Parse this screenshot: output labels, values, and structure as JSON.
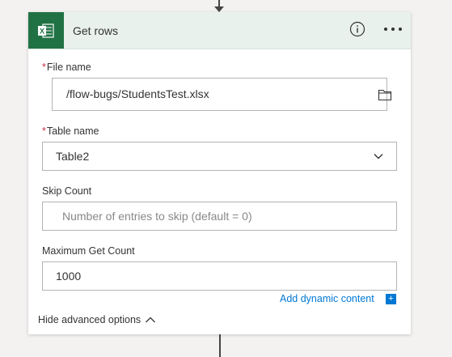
{
  "header": {
    "title": "Get rows",
    "connector_icon": "excel-icon",
    "info_icon": "info-icon",
    "more_icon": "more-options-icon"
  },
  "fields": {
    "file_name": {
      "label": "File name",
      "required_mark": "*",
      "value": "/flow-bugs/StudentsTest.xlsx",
      "icon": "folder-icon"
    },
    "table_name": {
      "label": "Table name",
      "required_mark": "*",
      "value": "Table2",
      "icon": "chevron-down-icon"
    },
    "skip_count": {
      "label": "Skip Count",
      "value": "",
      "placeholder": "Number of entries to skip (default = 0)"
    },
    "max_get_count": {
      "label": "Maximum Get Count",
      "value": "1000"
    }
  },
  "footer": {
    "dynamic_content_label": "Add dynamic content",
    "dynamic_content_plus": "+",
    "hide_advanced_label": "Hide advanced options"
  },
  "colors": {
    "excel_green": "#207245",
    "header_bg": "#e8f1ec",
    "link_blue": "#0078d4",
    "required_red": "#c4314b"
  }
}
